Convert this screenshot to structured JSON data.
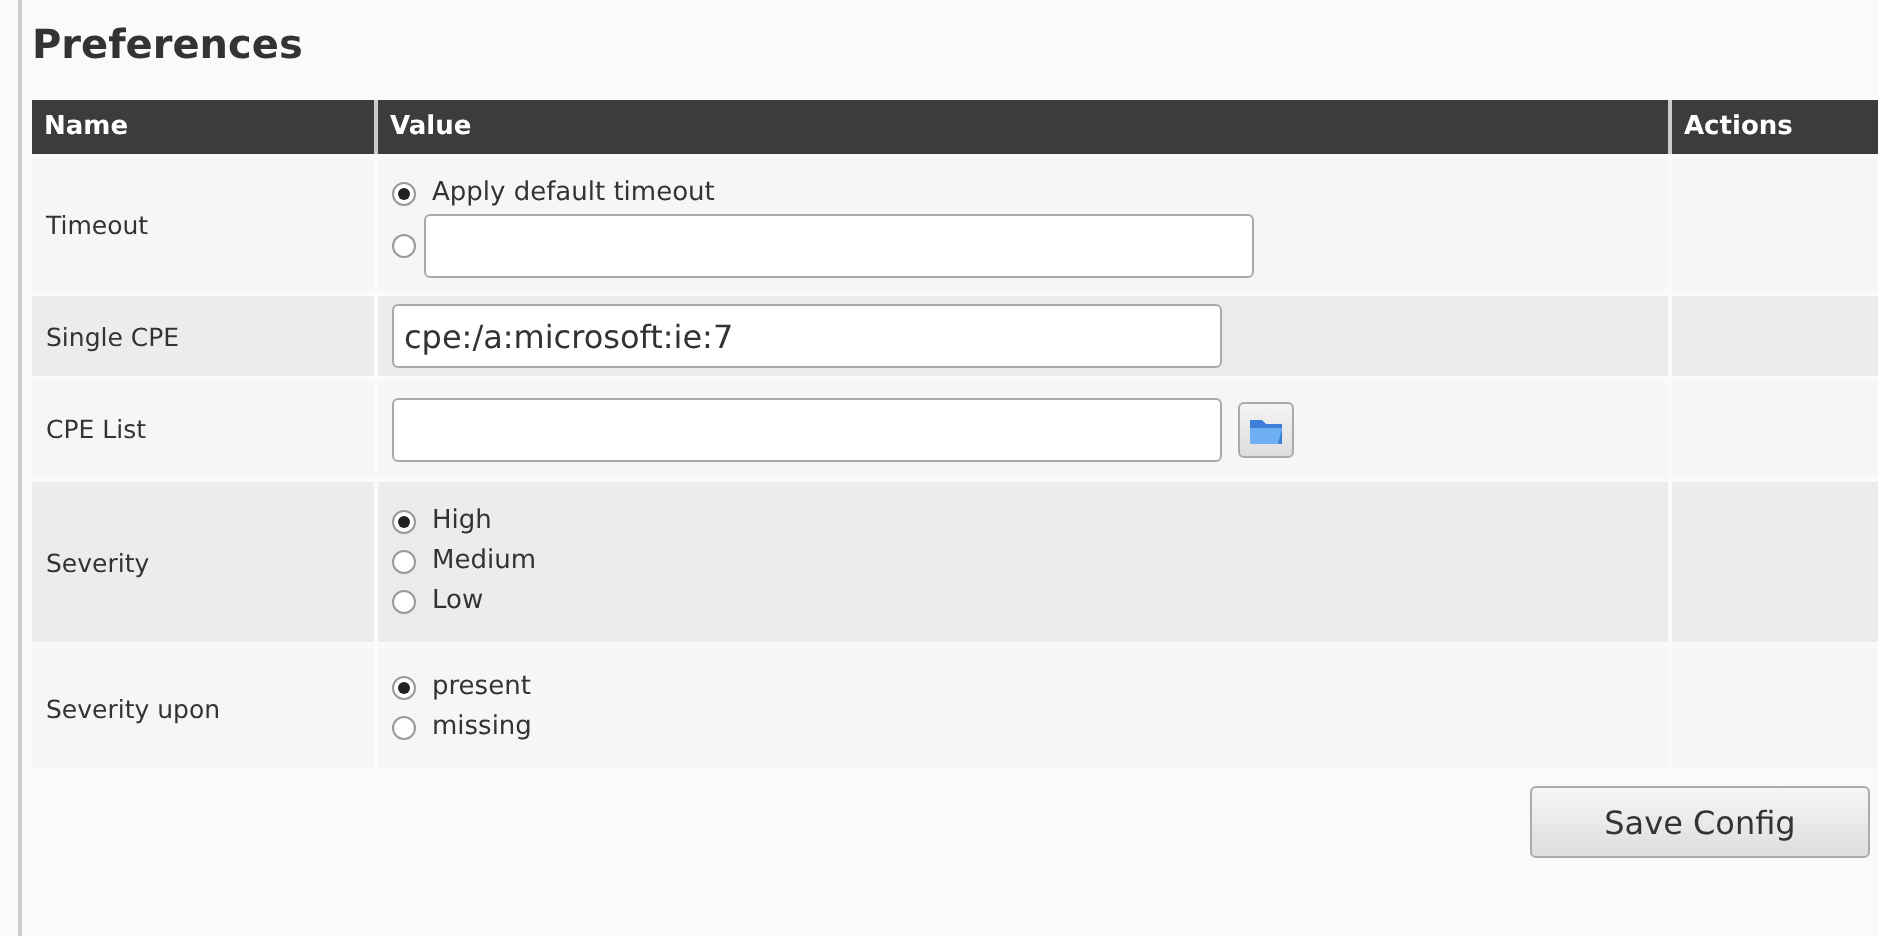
{
  "title": "Preferences",
  "table": {
    "columns": [
      "Name",
      "Value",
      "Actions"
    ],
    "rows": [
      {
        "name": "Timeout",
        "kind": "radio",
        "options": [
          {
            "kind": "label",
            "label": "Apply default timeout",
            "selected": true
          },
          {
            "kind": "field",
            "selected": false
          }
        ]
      },
      {
        "name": "Single CPE",
        "kind": "text",
        "value": "cpe:/a:microsoft:ie:7"
      },
      {
        "name": "CPE List",
        "kind": "file"
      },
      {
        "name": "Severity",
        "kind": "radio",
        "options": [
          {
            "kind": "label",
            "label": "High",
            "selected": true
          },
          {
            "kind": "label",
            "label": "Medium",
            "selected": false
          },
          {
            "kind": "label",
            "label": "Low",
            "selected": false
          }
        ]
      },
      {
        "name": "Severity upon",
        "kind": "radio",
        "options": [
          {
            "kind": "label",
            "label": "present",
            "selected": true
          },
          {
            "kind": "label",
            "label": "missing",
            "selected": false
          }
        ]
      }
    ]
  },
  "save_button": "Save Config"
}
